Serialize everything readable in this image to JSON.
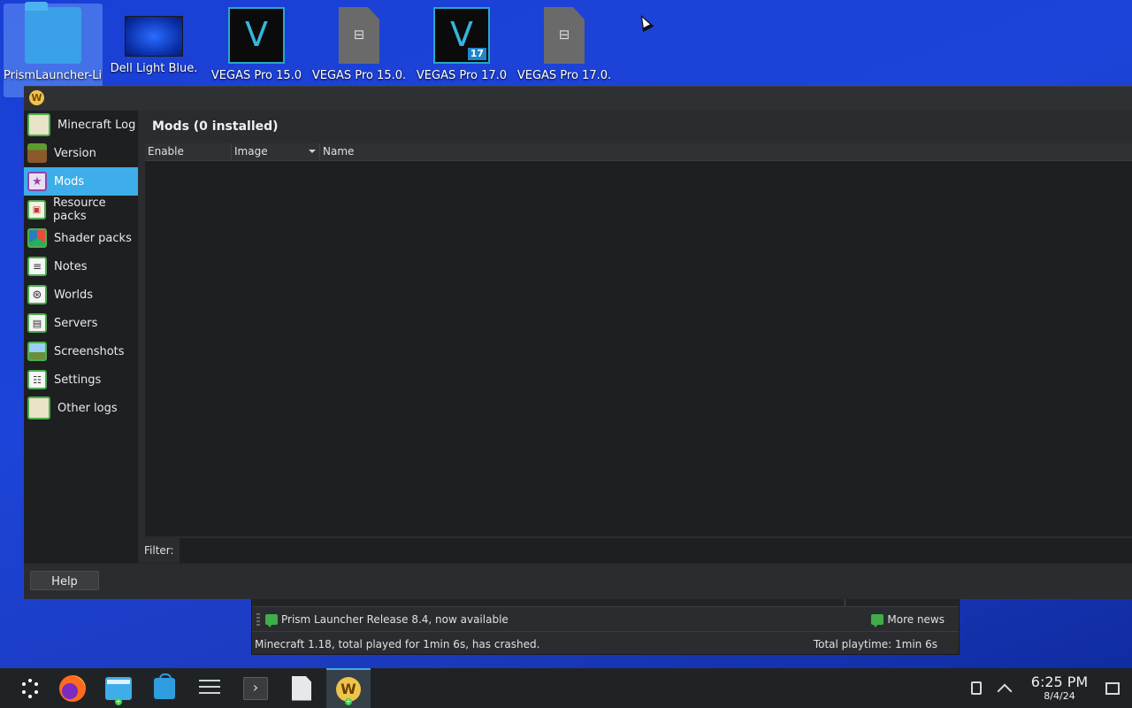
{
  "desktop": {
    "icons": [
      {
        "label": "PrismLauncher-Lin",
        "icon": "folder-icon",
        "selected": true
      },
      {
        "label": "Dell Light Blue.",
        "icon": "wallpaper-image-icon"
      },
      {
        "label": "VEGAS Pro 15.0",
        "icon": "vegas-logo-icon",
        "glyph": "V"
      },
      {
        "label": "VEGAS Pro 15.0.",
        "icon": "symlink-file-icon"
      },
      {
        "label": "VEGAS Pro 17.0",
        "icon": "vegas-logo-icon",
        "glyph": "V",
        "badge": "17"
      },
      {
        "label": "VEGAS Pro 17.0.",
        "icon": "symlink-file-icon"
      }
    ]
  },
  "window": {
    "app_icon_glyph": "W",
    "sidebar": {
      "items": [
        {
          "label": "Minecraft Log",
          "icon": "log-book-icon",
          "color": "#4caf50"
        },
        {
          "label": "Version",
          "icon": "grass-block-icon",
          "color": "#6b8e3a"
        },
        {
          "label": "Mods",
          "icon": "star-mod-icon",
          "color": "#8e44ad",
          "active": true
        },
        {
          "label": "Resource packs",
          "icon": "resource-pack-icon",
          "color": "#4caf50"
        },
        {
          "label": "Shader packs",
          "icon": "shader-cube-icon",
          "color": "#4caf50"
        },
        {
          "label": "Notes",
          "icon": "notes-icon",
          "color": "#4caf50"
        },
        {
          "label": "Worlds",
          "icon": "world-globe-icon",
          "color": "#4caf50"
        },
        {
          "label": "Servers",
          "icon": "server-icon",
          "color": "#4caf50"
        },
        {
          "label": "Screenshots",
          "icon": "screenshot-image-icon",
          "color": "#4caf50"
        },
        {
          "label": "Settings",
          "icon": "settings-checklist-icon",
          "color": "#4caf50"
        },
        {
          "label": "Other logs",
          "icon": "log-book-icon",
          "color": "#4caf50"
        }
      ]
    },
    "content": {
      "title": "Mods (0 installed)",
      "table": {
        "columns": [
          "Enable",
          "Image",
          "Name"
        ],
        "sorted_column": "Image",
        "rows": []
      },
      "filter": {
        "label": "Filter:",
        "value": ""
      }
    },
    "help_button": "Help"
  },
  "main_window_behind": {
    "news": "Prism Launcher Release 8.4, now available",
    "more_news": "More news",
    "status": "Minecraft 1.18, total played for 1min 6s, has crashed.",
    "total_playtime": "Total playtime: 1min 6s"
  },
  "taskbar": {
    "apps": [
      {
        "name": "application-launcher",
        "icon": "launcher-icon"
      },
      {
        "name": "firefox",
        "icon": "firefox-icon"
      },
      {
        "name": "file-manager",
        "icon": "files-icon"
      },
      {
        "name": "discover-store",
        "icon": "store-icon"
      },
      {
        "name": "system-settings",
        "icon": "sliders-icon"
      },
      {
        "name": "terminal",
        "icon": "terminal-icon",
        "glyph": "›"
      },
      {
        "name": "text-document",
        "icon": "document-icon"
      },
      {
        "name": "prism-launcher",
        "icon": "prism-launcher-icon",
        "glyph": "W",
        "active": true
      }
    ],
    "clock": {
      "time": "6:25 PM",
      "date": "8/4/24"
    }
  },
  "colors": {
    "accent": "#3daee9",
    "desktop_bg": "#1d44d8",
    "window_bg": "#2b2c2f",
    "panel_bg": "#202326"
  }
}
